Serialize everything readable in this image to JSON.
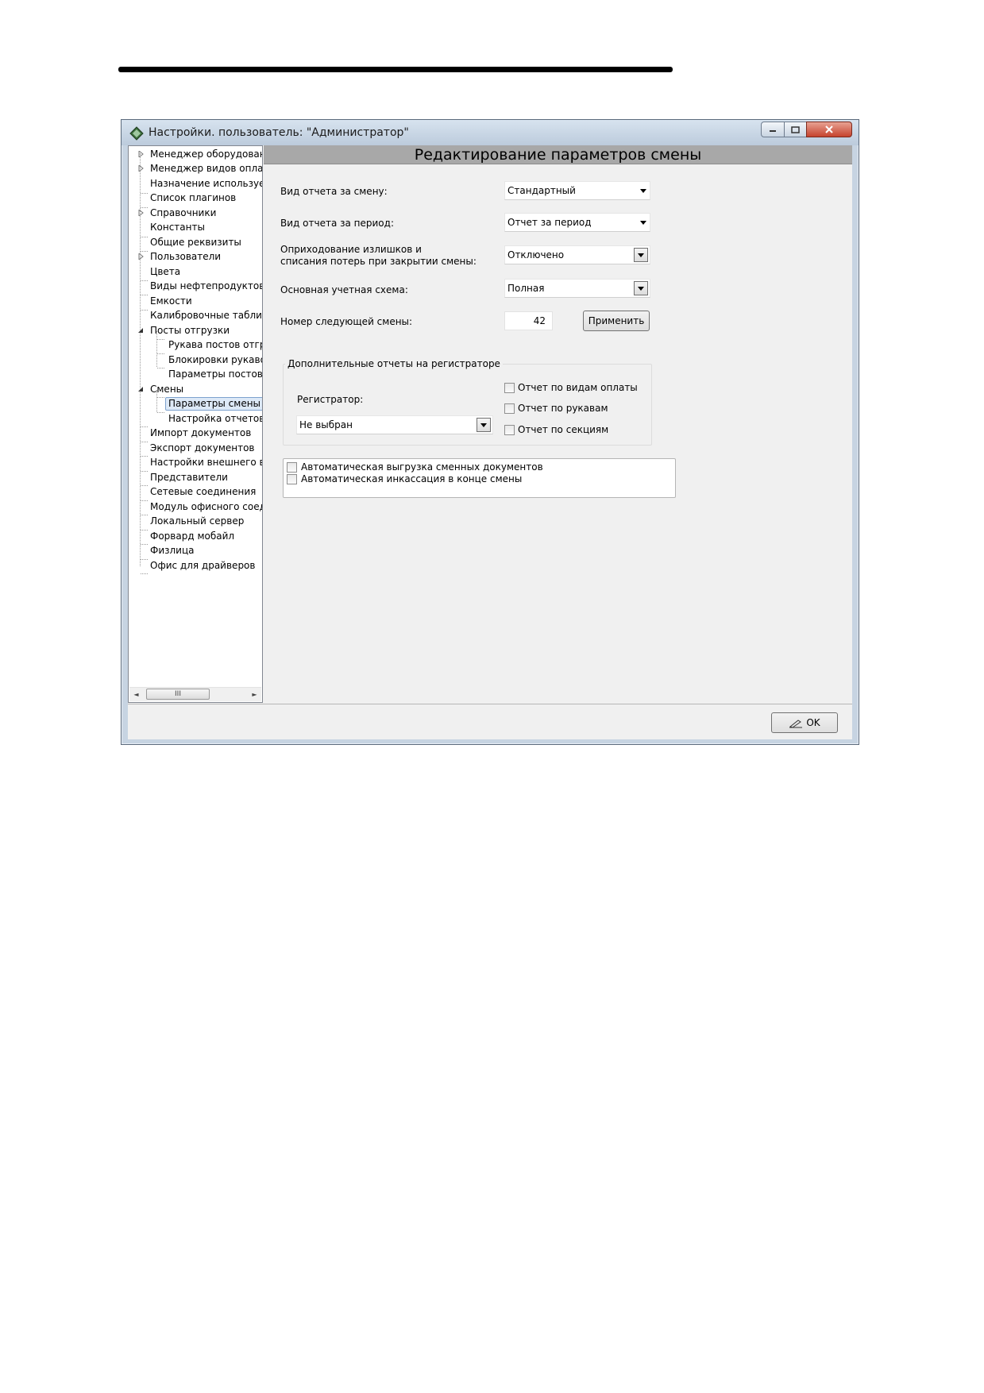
{
  "window": {
    "title": "Настройки. пользователь: \"Администратор\""
  },
  "tree": {
    "items": [
      {
        "label": "Менеджер оборудования"
      },
      {
        "label": "Менеджер видов оплат"
      },
      {
        "label": "Назначение используемых"
      },
      {
        "label": "Список плагинов"
      },
      {
        "label": "Справочники"
      },
      {
        "label": "Константы"
      },
      {
        "label": "Общие реквизиты"
      },
      {
        "label": "Пользователи"
      },
      {
        "label": "Цвета"
      },
      {
        "label": "Виды нефтепродуктов"
      },
      {
        "label": "Емкости"
      },
      {
        "label": "Калибровочные таблицы"
      },
      {
        "label": "Посты отгрузки"
      },
      {
        "label": "Рукава постов отгрузки"
      },
      {
        "label": "Блокировки рукавов"
      },
      {
        "label": "Параметры постов отгрузки"
      },
      {
        "label": "Смены"
      },
      {
        "label": "Параметры смены"
      },
      {
        "label": "Настройка отчетов"
      },
      {
        "label": "Импорт документов"
      },
      {
        "label": "Экспорт документов"
      },
      {
        "label": "Настройки внешнего вида"
      },
      {
        "label": "Представители"
      },
      {
        "label": "Сетевые соединения"
      },
      {
        "label": "Модуль офисного соединения"
      },
      {
        "label": "Локальный сервер"
      },
      {
        "label": "Форвард мобайл"
      },
      {
        "label": "Физлица"
      },
      {
        "label": "Офис для драйверов"
      }
    ],
    "selected": "Параметры смены",
    "scroll_thumb_glyph": "III"
  },
  "panel": {
    "header": "Редактирование параметров смены",
    "shift_report_label": "Вид отчета за смену:",
    "shift_report_value": "Стандартный",
    "period_report_label": "Вид отчета за период:",
    "period_report_value": "Отчет за период",
    "surplus_label_line1": "Оприходование излишков и",
    "surplus_label_line2": "списания потерь при закрытии смены:",
    "surplus_value": "Отключено",
    "accounting_scheme_label": "Основная учетная схема:",
    "accounting_scheme_value": "Полная",
    "next_shift_label": "Номер следующей смены:",
    "next_shift_value": "42",
    "apply_button": "Применить",
    "extra_reports_group": {
      "title": "Дополнительные отчеты на регистраторе",
      "registrar_label": "Регистратор:",
      "registrar_value": "Не выбран",
      "checkboxes": [
        {
          "label": "Отчет по видам оплаты",
          "checked": false
        },
        {
          "label": "Отчет по рукавам",
          "checked": false
        },
        {
          "label": "Отчет по секциям",
          "checked": false
        }
      ]
    },
    "auto_options": [
      {
        "label": "Автоматическая выгрузка сменных документов",
        "checked": false
      },
      {
        "label": "Автоматическая инкассация в конце смены",
        "checked": false
      }
    ]
  },
  "footer": {
    "ok_button": "OK"
  }
}
